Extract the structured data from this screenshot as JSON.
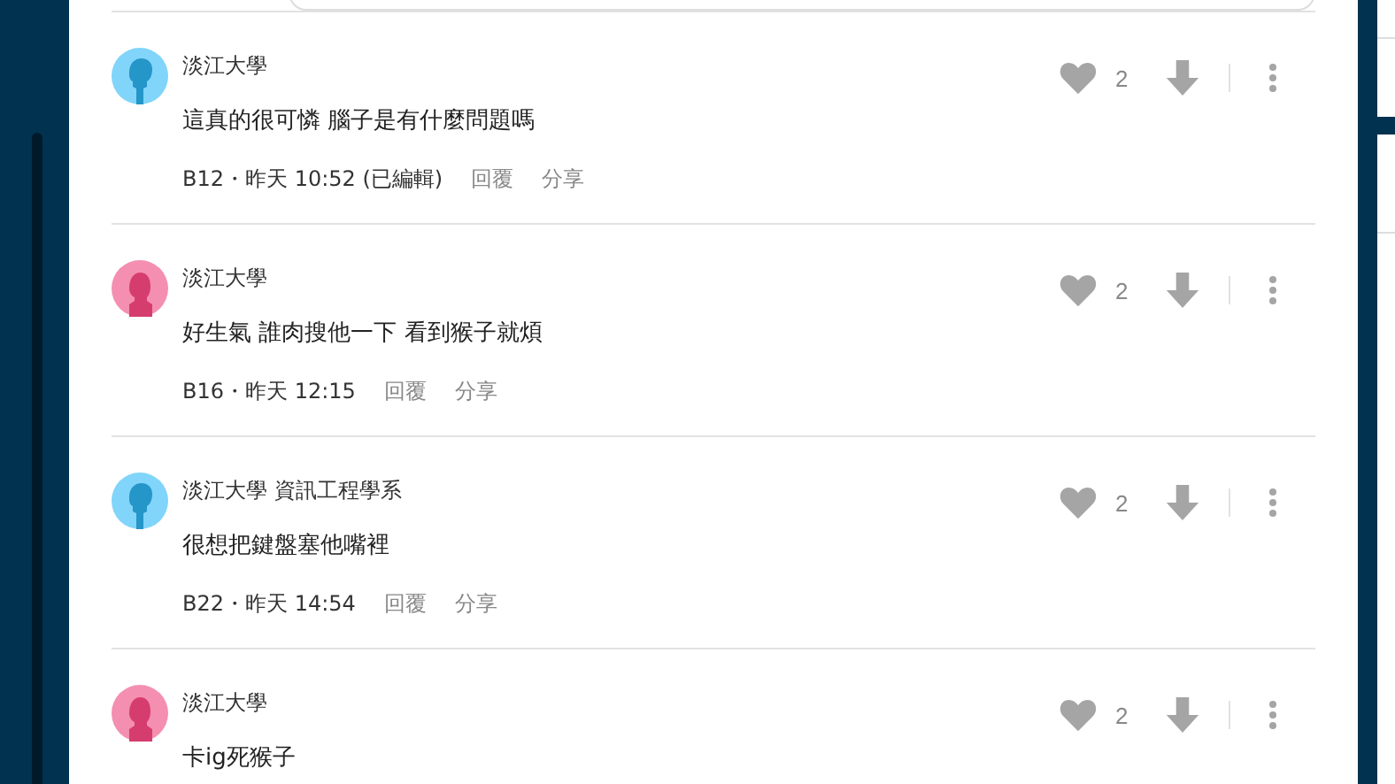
{
  "comments": [
    {
      "author": "淡江大學",
      "kind": "male",
      "text": "這真的很可憐 腦子是有什麼問題嗎",
      "meta": "B12・昨天 10:52 (已編輯)",
      "reply": "回覆",
      "share": "分享",
      "likes": "2"
    },
    {
      "author": "淡江大學",
      "kind": "female",
      "text": "好生氣 誰肉搜他一下 看到猴子就煩",
      "meta": "B16・昨天 12:15",
      "reply": "回覆",
      "share": "分享",
      "likes": "2"
    },
    {
      "author": "淡江大學 資訊工程學系",
      "kind": "male",
      "text": "很想把鍵盤塞他嘴裡",
      "meta": "B22・昨天 14:54",
      "reply": "回覆",
      "share": "分享",
      "likes": "2"
    },
    {
      "author": "淡江大學",
      "kind": "female",
      "text": "卡ig死猴子",
      "likes": "2"
    }
  ]
}
